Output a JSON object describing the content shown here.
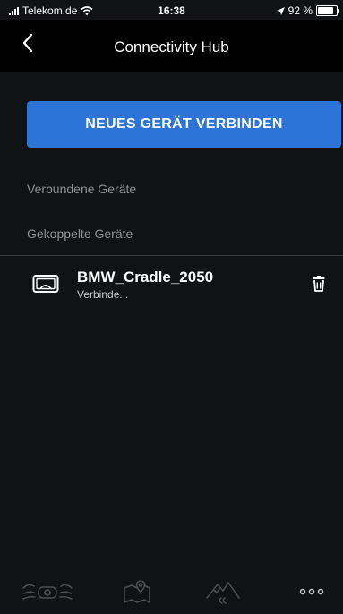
{
  "status_bar": {
    "carrier": "Telekom.de",
    "time": "16:38",
    "battery": "92 %",
    "battery_level": 0.92
  },
  "header": {
    "title": "Connectivity Hub",
    "back_icon": "chevron-left-icon"
  },
  "connect_button": {
    "label": "NEUES GERÄT VERBINDEN"
  },
  "sections": {
    "connected": "Verbundene Geräte",
    "paired": "Gekoppelte Geräte"
  },
  "devices": [
    {
      "name": "BMW_Cradle_2050",
      "status": "Verbinde...",
      "icon": "cradle-device-icon",
      "action_icon": "trash-icon"
    }
  ],
  "bottom_nav": [
    {
      "icon": "motorcycle-icon"
    },
    {
      "icon": "map-icon"
    },
    {
      "icon": "mountain-icon"
    },
    {
      "icon": "more-icon"
    }
  ],
  "colors": {
    "accent": "#2c74d8",
    "background": "#111214",
    "header": "#000000"
  }
}
